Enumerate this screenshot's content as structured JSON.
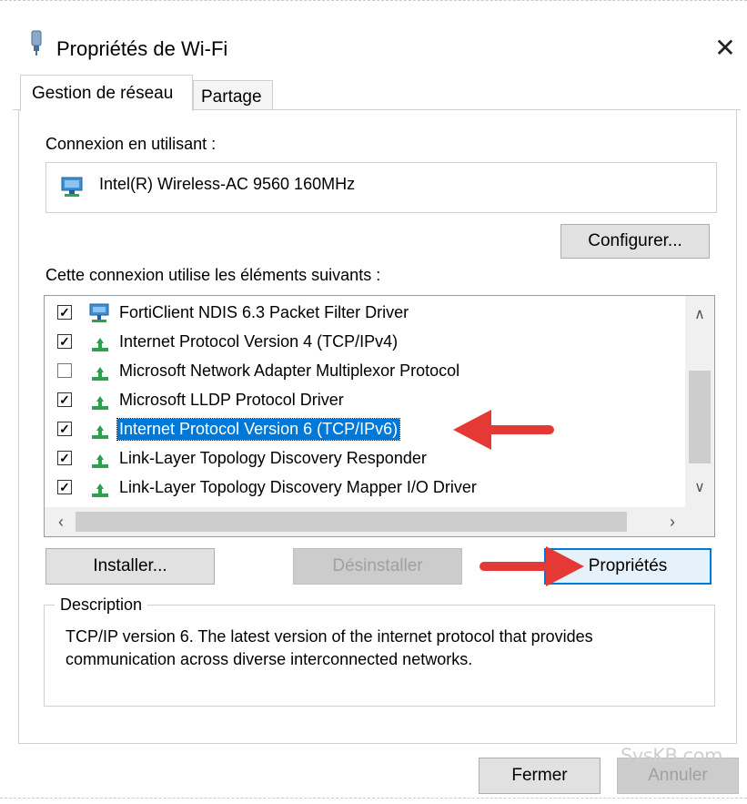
{
  "window": {
    "title": "Propriétés de Wi-Fi",
    "close_glyph": "✕",
    "icon": "network-adapter-icon"
  },
  "tabs": [
    {
      "label": "Gestion de réseau",
      "active": true
    },
    {
      "label": "Partage",
      "active": false
    }
  ],
  "connection": {
    "label": "Connexion en utilisant :",
    "adapter": "Intel(R) Wireless-AC 9560 160MHz",
    "adapter_icon": "network-adapter-icon",
    "configure_button": "Configurer..."
  },
  "components": {
    "label": "Cette connexion utilise les éléments suivants :",
    "items": [
      {
        "label": "FortiClient NDIS 6.3 Packet Filter Driver",
        "checked": true,
        "icon": "network-service-icon",
        "selected": false
      },
      {
        "label": "Internet Protocol Version 4 (TCP/IPv4)",
        "checked": true,
        "icon": "protocol-icon",
        "selected": false
      },
      {
        "label": "Microsoft Network Adapter Multiplexor Protocol",
        "checked": false,
        "icon": "protocol-icon",
        "selected": false
      },
      {
        "label": "Microsoft LLDP Protocol Driver",
        "checked": true,
        "icon": "protocol-icon",
        "selected": false
      },
      {
        "label": "Internet Protocol Version 6 (TCP/IPv6)",
        "checked": true,
        "icon": "protocol-icon",
        "selected": true
      },
      {
        "label": "Link-Layer Topology Discovery Responder",
        "checked": true,
        "icon": "protocol-icon",
        "selected": false
      },
      {
        "label": "Link-Layer Topology Discovery Mapper I/O Driver",
        "checked": true,
        "icon": "protocol-icon",
        "selected": false
      }
    ],
    "check_glyph": "✓"
  },
  "buttons": {
    "install": "Installer...",
    "uninstall": "Désinstaller",
    "properties": "Propriétés",
    "close": "Fermer",
    "cancel": "Annuler"
  },
  "description": {
    "legend": "Description",
    "text": "TCP/IP version 6. The latest version of the internet protocol that provides communication across diverse interconnected networks."
  },
  "watermark": "SysKB.com",
  "colors": {
    "selection": "#0078d7",
    "annotation_arrow": "#e53935",
    "protocol_icon": "#2e9e4f"
  }
}
